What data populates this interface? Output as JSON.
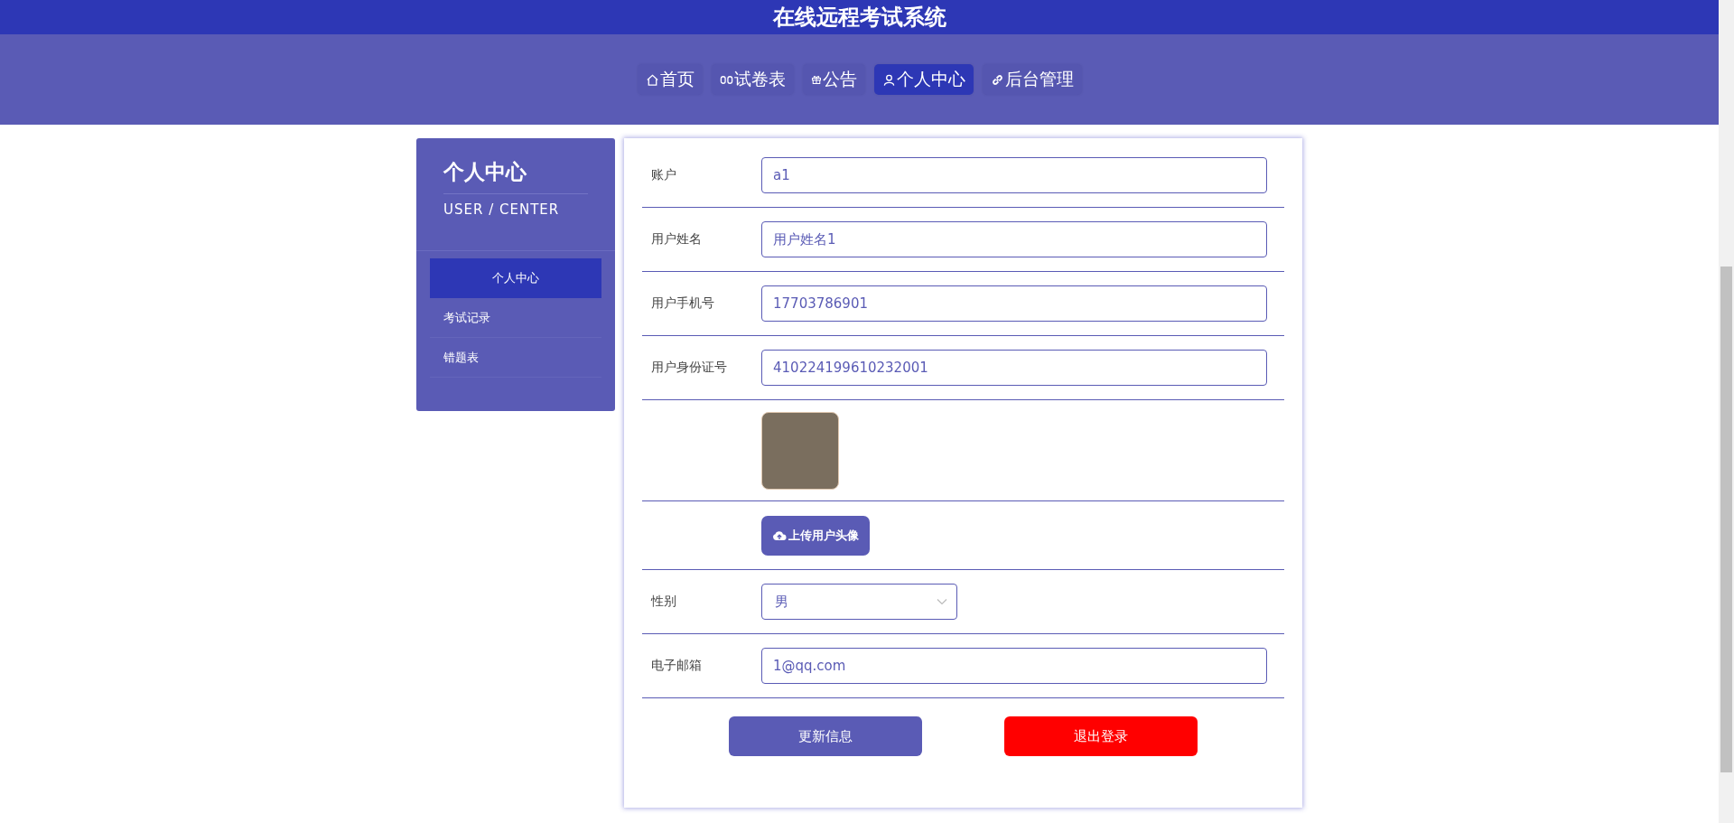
{
  "header": {
    "title": "在线远程考试系统"
  },
  "nav": [
    {
      "label": "首页",
      "kind": "home",
      "selected": false
    },
    {
      "label": "试卷表",
      "kind": "paper",
      "selected": false
    },
    {
      "label": "公告",
      "kind": "gift",
      "selected": false
    },
    {
      "label": "个人中心",
      "kind": "user",
      "selected": true
    },
    {
      "label": "后台管理",
      "kind": "link",
      "selected": false
    }
  ],
  "sidebar": {
    "title": "个人中心",
    "subtitle": "USER / CENTER",
    "items": [
      {
        "label": "个人中心",
        "selected": true
      },
      {
        "label": "考试记录",
        "selected": false
      },
      {
        "label": "错题表",
        "selected": false
      }
    ]
  },
  "form": {
    "rows": [
      {
        "kind": "input",
        "label": "账户",
        "value": "a1"
      },
      {
        "kind": "input",
        "label": "用户姓名",
        "value": "用户姓名1"
      },
      {
        "kind": "input",
        "label": "用户手机号",
        "value": "17703786901"
      },
      {
        "kind": "input",
        "label": "用户身份证号",
        "value": "410224199610232001"
      },
      {
        "kind": "avatar"
      },
      {
        "kind": "upload",
        "button": "上传用户头像"
      },
      {
        "kind": "select",
        "label": "性别",
        "value": "男"
      },
      {
        "kind": "input",
        "label": "电子邮箱",
        "value": "1@qq.com"
      }
    ],
    "buttons": [
      {
        "label": "更新信息",
        "kind": "primary"
      },
      {
        "label": "退出登录",
        "kind": "danger"
      }
    ]
  }
}
